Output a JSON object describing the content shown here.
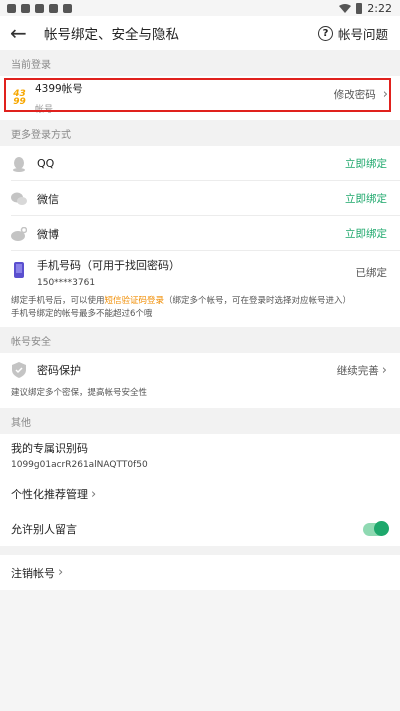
{
  "status": {
    "time": "2:22"
  },
  "appbar": {
    "title": "帐号绑定、安全与隐私",
    "help_label": "帐号问题"
  },
  "sections": {
    "current": "当前登录",
    "more": "更多登录方式",
    "security": "帐号安全",
    "other": "其他"
  },
  "current_login": {
    "logo_top": "43",
    "logo_bottom": "99",
    "name": "4399帐号",
    "sub": "帐号",
    "action": "修改密码"
  },
  "bindings": [
    {
      "label": "QQ",
      "action": "立即绑定"
    },
    {
      "label": "微信",
      "action": "立即绑定"
    },
    {
      "label": "微博",
      "action": "立即绑定"
    }
  ],
  "phone": {
    "label": "手机号码（可用于找回密码）",
    "number": "150****3761",
    "status": "已绑定",
    "note_part1": "绑定手机号后，可以使用",
    "note_link": "短信验证码登录",
    "note_part2": "（绑定多个帐号，可在登录时选择对应帐号进入）",
    "note_line2": "手机号绑定的帐号最多不能超过6个哦"
  },
  "password": {
    "label": "密码保护",
    "action": "继续完善",
    "note": "建议绑定多个密保，提高帐号安全性"
  },
  "other": {
    "id_label": "我的专属识别码",
    "id_value": "1099g01acrR261alNAQTT0f50",
    "recommend_label": "个性化推荐管理",
    "comments_label": "允许别人留言",
    "cancel_label": "注销帐号"
  }
}
